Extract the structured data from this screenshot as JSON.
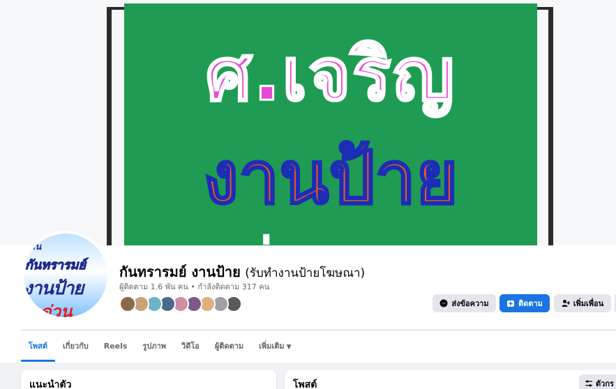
{
  "cover": {
    "sign_line1": "ศ.เจริญ",
    "sign_line2": "งานป้าย",
    "sign_line3": "ด่วนจบ"
  },
  "avatar": {
    "line1": "ร้าน",
    "line2": "กันทรารมย์",
    "line3": "งานป้าย",
    "line4": "ด่วน"
  },
  "page": {
    "name": "กันทรารมย์ งานป้าย",
    "subname": "(รับทำงานป้ายโฆษณา)",
    "stats": "ผู้ติดตาม 1.6 พัน คน • กำลังติดตาม 317 คน"
  },
  "followers_avatars": [
    "#8a6a4a",
    "#c9a27a",
    "#6fb3c9",
    "#4a6b8a",
    "#d18fa5",
    "#7a5a8a",
    "#e0b080",
    "#a0a0a0",
    "#5a5a5a"
  ],
  "actions": {
    "message": "ส่งข้อความ",
    "follow": "ติดตาม",
    "add_friend": "เพิ่มเพื่อน"
  },
  "tabs": [
    {
      "label": "โพสต์",
      "active": true
    },
    {
      "label": "เกี่ยวกับ"
    },
    {
      "label": "Reels"
    },
    {
      "label": "รูปภาพ"
    },
    {
      "label": "วิดีโอ"
    },
    {
      "label": "ผู้ติดตาม"
    },
    {
      "label": "เพิ่มเติม"
    }
  ],
  "intro_card": {
    "title": "แนะนำตัว"
  },
  "posts_card": {
    "title": "โพสต์",
    "filter_label": "ตัวกร"
  },
  "colors": {
    "accent": "#1b74e4",
    "sign_green": "#1f9b53",
    "sign_pink": "#e54ad6",
    "sign_orange": "#ff5a16"
  }
}
